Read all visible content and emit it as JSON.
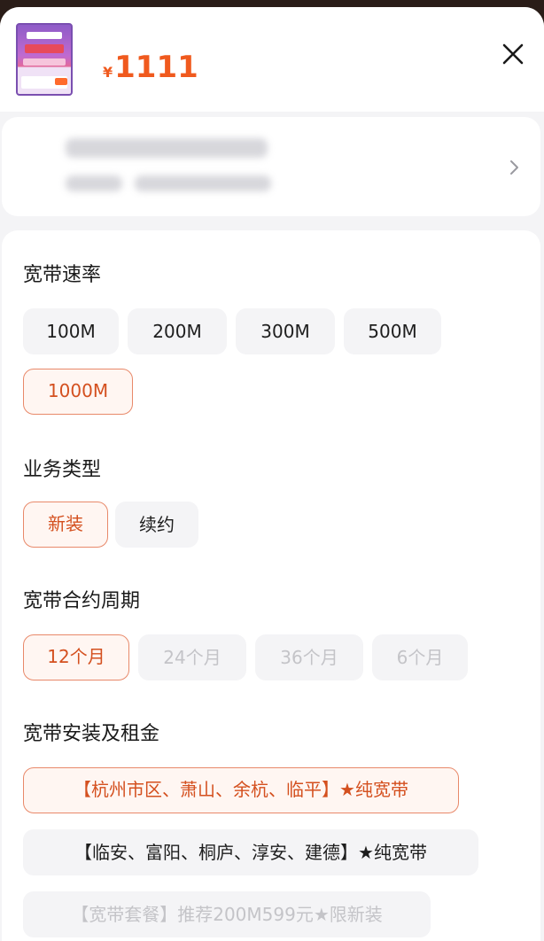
{
  "price": {
    "currency": "¥",
    "amount": "1111"
  },
  "sections": {
    "speed": {
      "title": "宽带速率",
      "options": [
        "100M",
        "200M",
        "300M",
        "500M",
        "1000M"
      ],
      "selected": "1000M"
    },
    "business": {
      "title": "业务类型",
      "options": [
        "新装",
        "续约"
      ],
      "selected": "新装"
    },
    "contract": {
      "title": "宽带合约周期",
      "options": [
        "12个月",
        "24个月",
        "36个月",
        "6个月"
      ],
      "selected": "12个月",
      "disabled": [
        "24个月",
        "36个月",
        "6个月"
      ]
    },
    "install": {
      "title": "宽带安装及租金",
      "options": [
        "【杭州市区、萧山、余杭、临平】★纯宽带",
        "【临安、富阳、桐庐、淳安、建德】★纯宽带",
        "【宽带套餐】推荐200M599元★限新装"
      ],
      "selected": "【杭州市区、萧山、余杭、临平】★纯宽带",
      "disabled": [
        "【宽带套餐】推荐200M599元★限新装"
      ]
    }
  },
  "icons": {
    "close": "close-icon",
    "location": "location-pin-icon",
    "chevron": "chevron-right-icon"
  },
  "colors": {
    "accent": "#f05a1e",
    "selected_border": "#e8896a",
    "selected_bg": "#fff6f2",
    "chip_bg": "#f4f4f6"
  }
}
